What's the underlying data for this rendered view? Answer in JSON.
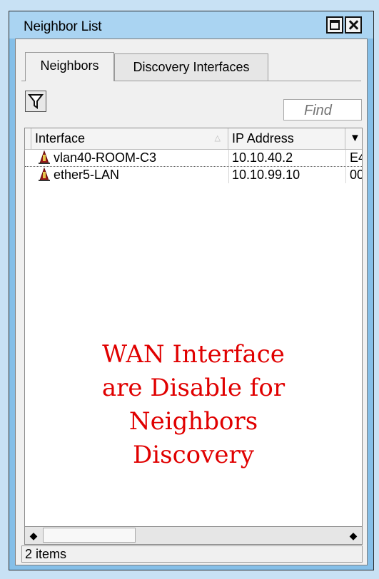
{
  "window": {
    "title": "Neighbor List"
  },
  "tabs": [
    {
      "label": "Neighbors",
      "active": true
    },
    {
      "label": "Discovery Interfaces",
      "active": false
    }
  ],
  "toolbar": {
    "filter_icon": "funnel-icon",
    "find_placeholder": "Find"
  },
  "table": {
    "columns": [
      "Interface",
      "IP Address",
      ""
    ],
    "rows": [
      {
        "interface": "vlan40-ROOM-C3",
        "ip": "10.10.40.2",
        "mac": "E4:"
      },
      {
        "interface": "ether5-LAN",
        "ip": "10.10.99.10",
        "mac": "00:"
      }
    ]
  },
  "overlay_text": [
    "WAN Interface",
    "are Disable for",
    "Neighbors",
    "Discovery"
  ],
  "status": {
    "items": "2 items"
  },
  "colors": {
    "window_bg": "#85bfe8",
    "overlay_text": "#e00000",
    "icon": "#8a1010"
  }
}
